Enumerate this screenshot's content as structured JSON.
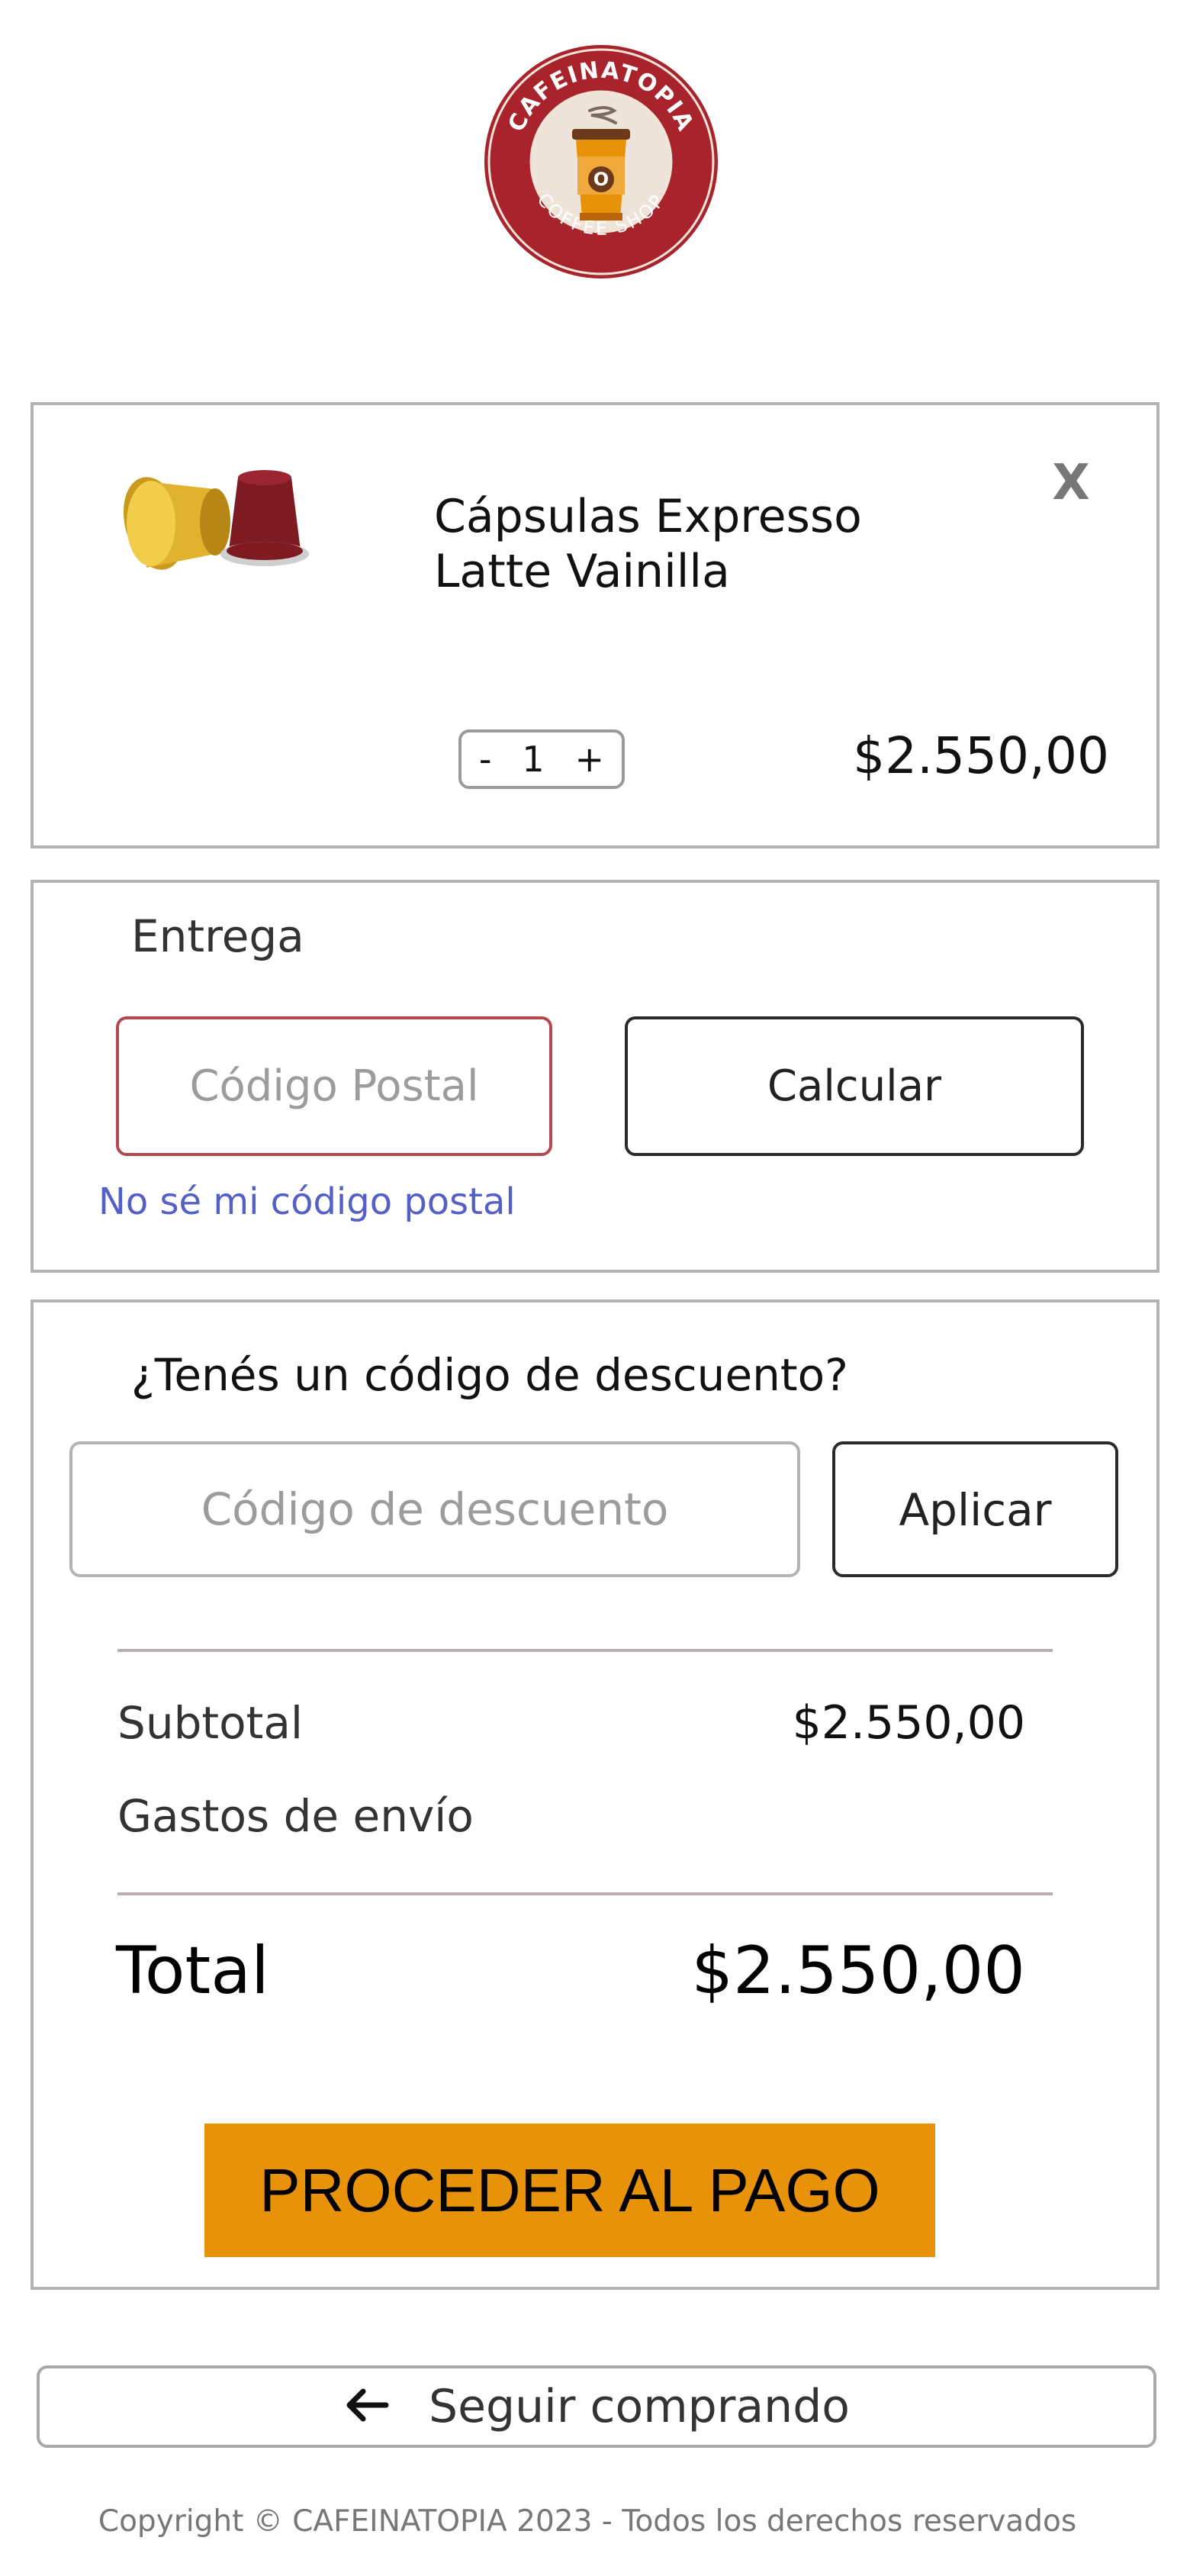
{
  "logo": {
    "text_top": "CAFEINATOPIA",
    "text_bottom": "COFFEE SHOP",
    "icon": "coffee-cup-icon"
  },
  "colors": {
    "brand_red": "#a8232b",
    "checkout_orange": "#e8920a",
    "link_blue": "#5560c6",
    "invalid_input_border": "#b5484c"
  },
  "cart": {
    "item": {
      "name_line1": "Cápsulas Expresso",
      "name_line2": "Latte Vainilla",
      "remove_label": "X",
      "qty_decrement": "-",
      "quantity": "1",
      "qty_increment": "+",
      "price": "$2.550,00",
      "image_icon": "coffee-capsules-image"
    }
  },
  "delivery": {
    "title": "Entrega",
    "postal_placeholder": "Código Postal",
    "calculate_label": "Calcular",
    "help_link": "No sé mi código postal"
  },
  "discount": {
    "title": "¿Tenés un código de descuento?",
    "placeholder": "Código de descuento",
    "apply_label": "Aplicar"
  },
  "summary": {
    "subtotal_label": "Subtotal",
    "subtotal_value": "$2.550,00",
    "shipping_label": "Gastos de envío",
    "total_label": "Total",
    "total_value": "$2.550,00",
    "checkout_label": "PROCEDER AL PAGO"
  },
  "continue_shopping": {
    "label": "Seguir comprando",
    "icon": "arrow-left-icon"
  },
  "footer": {
    "copyright": "Copyright © CAFEINATOPIA 2023 - Todos los derechos reservados"
  }
}
